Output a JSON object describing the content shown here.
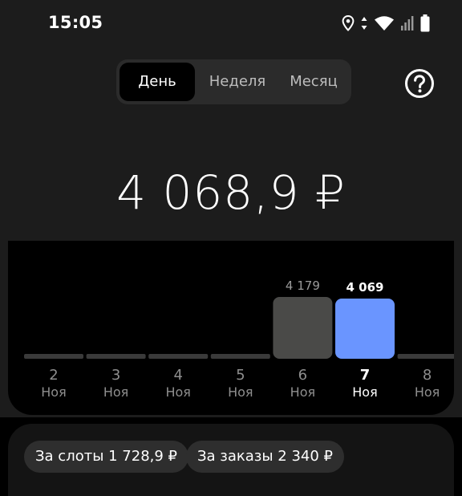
{
  "status_bar": {
    "time": "15:05",
    "icons": [
      "location-icon",
      "wifi-icon",
      "signal-icon",
      "battery-icon"
    ]
  },
  "period_tabs": {
    "items": [
      {
        "label": "День",
        "selected": true
      },
      {
        "label": "Неделя",
        "selected": false
      },
      {
        "label": "Месяц",
        "selected": false
      }
    ]
  },
  "help_icon": "help-icon",
  "total": "4 068,9 ₽",
  "colors": {
    "bar_default": "#4a4a48",
    "bar_selected": "#6a95ff",
    "baseline": "#3a3a3a"
  },
  "chart_data": {
    "type": "bar",
    "categories": [
      "2",
      "3",
      "4",
      "5",
      "6",
      "7",
      "8"
    ],
    "sublabel": [
      "Ноя",
      "Ноя",
      "Ноя",
      "Ноя",
      "Ноя",
      "Ноя",
      "Ноя"
    ],
    "values": [
      0,
      0,
      0,
      0,
      4179,
      4069,
      0
    ],
    "value_labels": [
      "",
      "",
      "",
      "",
      "4 179",
      "4 069",
      ""
    ],
    "selected_index": 5
  },
  "chips": {
    "slots": "За слоты 1 728,9 ₽",
    "orders": "За заказы 2 340 ₽"
  }
}
